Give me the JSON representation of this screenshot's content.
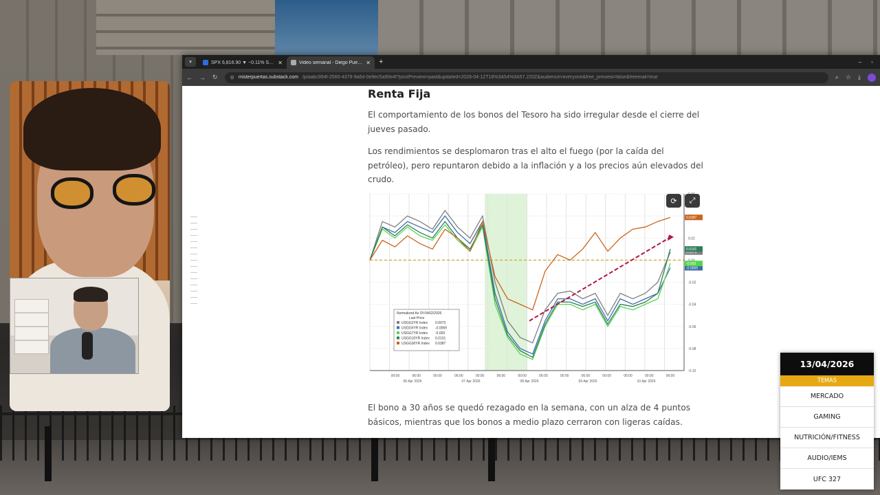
{
  "browser": {
    "tabs": [
      {
        "title": "SPX 6,816.90 ▼ −0.11% Sector…",
        "active": false
      },
      {
        "title": "Video semanal - Diego Puertas",
        "active": true
      }
    ],
    "url_host": "misterpuertas.substack.com",
    "url_path": "/p/aabc994f-2560-4379-9a6d-0e9ec5a90e4f?postPreview=paid&updated=2026-04-12T18%3A54%3A57.220Z&audience=everyone&free_preview=false&freemail=true"
  },
  "article": {
    "heading": "Renta Fija",
    "paragraph1": "El comportamiento de los bonos del Tesoro ha sido irregular desde el cierre del jueves pasado.",
    "paragraph2": "Los rendimientos se desplomaron tras el alto el fuego (por la caída del petróleo), pero repuntaron debido a la inflación y a los precios aún elevados del crudo.",
    "paragraph3": "El bono a 30 años se quedó rezagado en la semana, con un alza de 4 puntos básicos, mientras que los bonos a medio plazo cerraron con ligeras caídas."
  },
  "chart_data": {
    "type": "line",
    "x_tick_labels": [
      "00:00",
      "06:00",
      "00:00",
      "06:00",
      "00:00",
      "06:00",
      "00:00",
      "06:00",
      "00:00",
      "06:00",
      "00:00",
      "06:00",
      "00:00",
      "06:00"
    ],
    "date_labels": [
      "06 Apr 2026",
      "07 Apr 2026",
      "08 Apr 2026",
      "09 Apr 2026",
      "10 Apr 2026"
    ],
    "y_tick_labels": [
      "0.06",
      "0.04",
      "0.02",
      "0.00",
      "-0.02",
      "-0.04",
      "-0.06",
      "-0.08",
      "-0.10"
    ],
    "ylim": [
      -0.1,
      0.06
    ],
    "legend_title": "Normalized As Of 04/02/2026",
    "legend_subtitle": "Last Price",
    "series": [
      {
        "name": "USGG2YR Index",
        "last": "0.0073",
        "color": "#7f7f7f",
        "values": [
          0.0,
          0.035,
          0.03,
          0.04,
          0.035,
          0.028,
          0.045,
          0.03,
          0.02,
          0.04,
          -0.02,
          -0.055,
          -0.07,
          -0.075,
          -0.045,
          -0.03,
          -0.028,
          -0.035,
          -0.03,
          -0.05,
          -0.03,
          -0.035,
          -0.03,
          -0.02,
          0.0073
        ]
      },
      {
        "name": "USGG5YR Index",
        "last": "-0.0069",
        "color": "#3a6ea5",
        "values": [
          0.0,
          0.03,
          0.025,
          0.035,
          0.03,
          0.025,
          0.04,
          0.025,
          0.015,
          0.035,
          -0.03,
          -0.065,
          -0.08,
          -0.085,
          -0.055,
          -0.035,
          -0.035,
          -0.04,
          -0.035,
          -0.055,
          -0.035,
          -0.04,
          -0.035,
          -0.03,
          -0.0069
        ]
      },
      {
        "name": "USGG7YR Index",
        "last": "-0.003",
        "color": "#55d64f",
        "values": [
          0.0,
          0.028,
          0.02,
          0.03,
          0.022,
          0.018,
          0.032,
          0.018,
          0.008,
          0.03,
          -0.04,
          -0.07,
          -0.085,
          -0.09,
          -0.06,
          -0.04,
          -0.04,
          -0.045,
          -0.04,
          -0.06,
          -0.042,
          -0.045,
          -0.04,
          -0.035,
          -0.003
        ]
      },
      {
        "name": "USGG10YR Index",
        "last": "0.0101",
        "color": "#2f7d5c",
        "values": [
          0.0,
          0.03,
          0.022,
          0.032,
          0.025,
          0.02,
          0.035,
          0.02,
          0.01,
          0.032,
          -0.035,
          -0.068,
          -0.082,
          -0.088,
          -0.058,
          -0.038,
          -0.038,
          -0.042,
          -0.038,
          -0.058,
          -0.04,
          -0.042,
          -0.038,
          -0.03,
          0.0101
        ]
      },
      {
        "name": "USGG30YR Index",
        "last": "0.0387",
        "color": "#c9651d",
        "values": [
          0.0,
          0.018,
          0.012,
          0.022,
          0.015,
          0.01,
          0.028,
          0.02,
          0.008,
          0.035,
          -0.015,
          -0.035,
          -0.04,
          -0.045,
          -0.01,
          0.005,
          0.0,
          0.01,
          0.025,
          0.008,
          0.02,
          0.028,
          0.03,
          0.035,
          0.0387
        ]
      }
    ],
    "grid": true,
    "legend_position": "bottom-left",
    "buttons": [
      "refresh",
      "expand"
    ]
  },
  "topics": {
    "date": "13/04/2026",
    "label": "TEMAS",
    "items": [
      "MERCADO",
      "GAMING",
      "NUTRICIÓN/FITNESS",
      "AUDIO/IEMS",
      "UFC 327"
    ]
  }
}
